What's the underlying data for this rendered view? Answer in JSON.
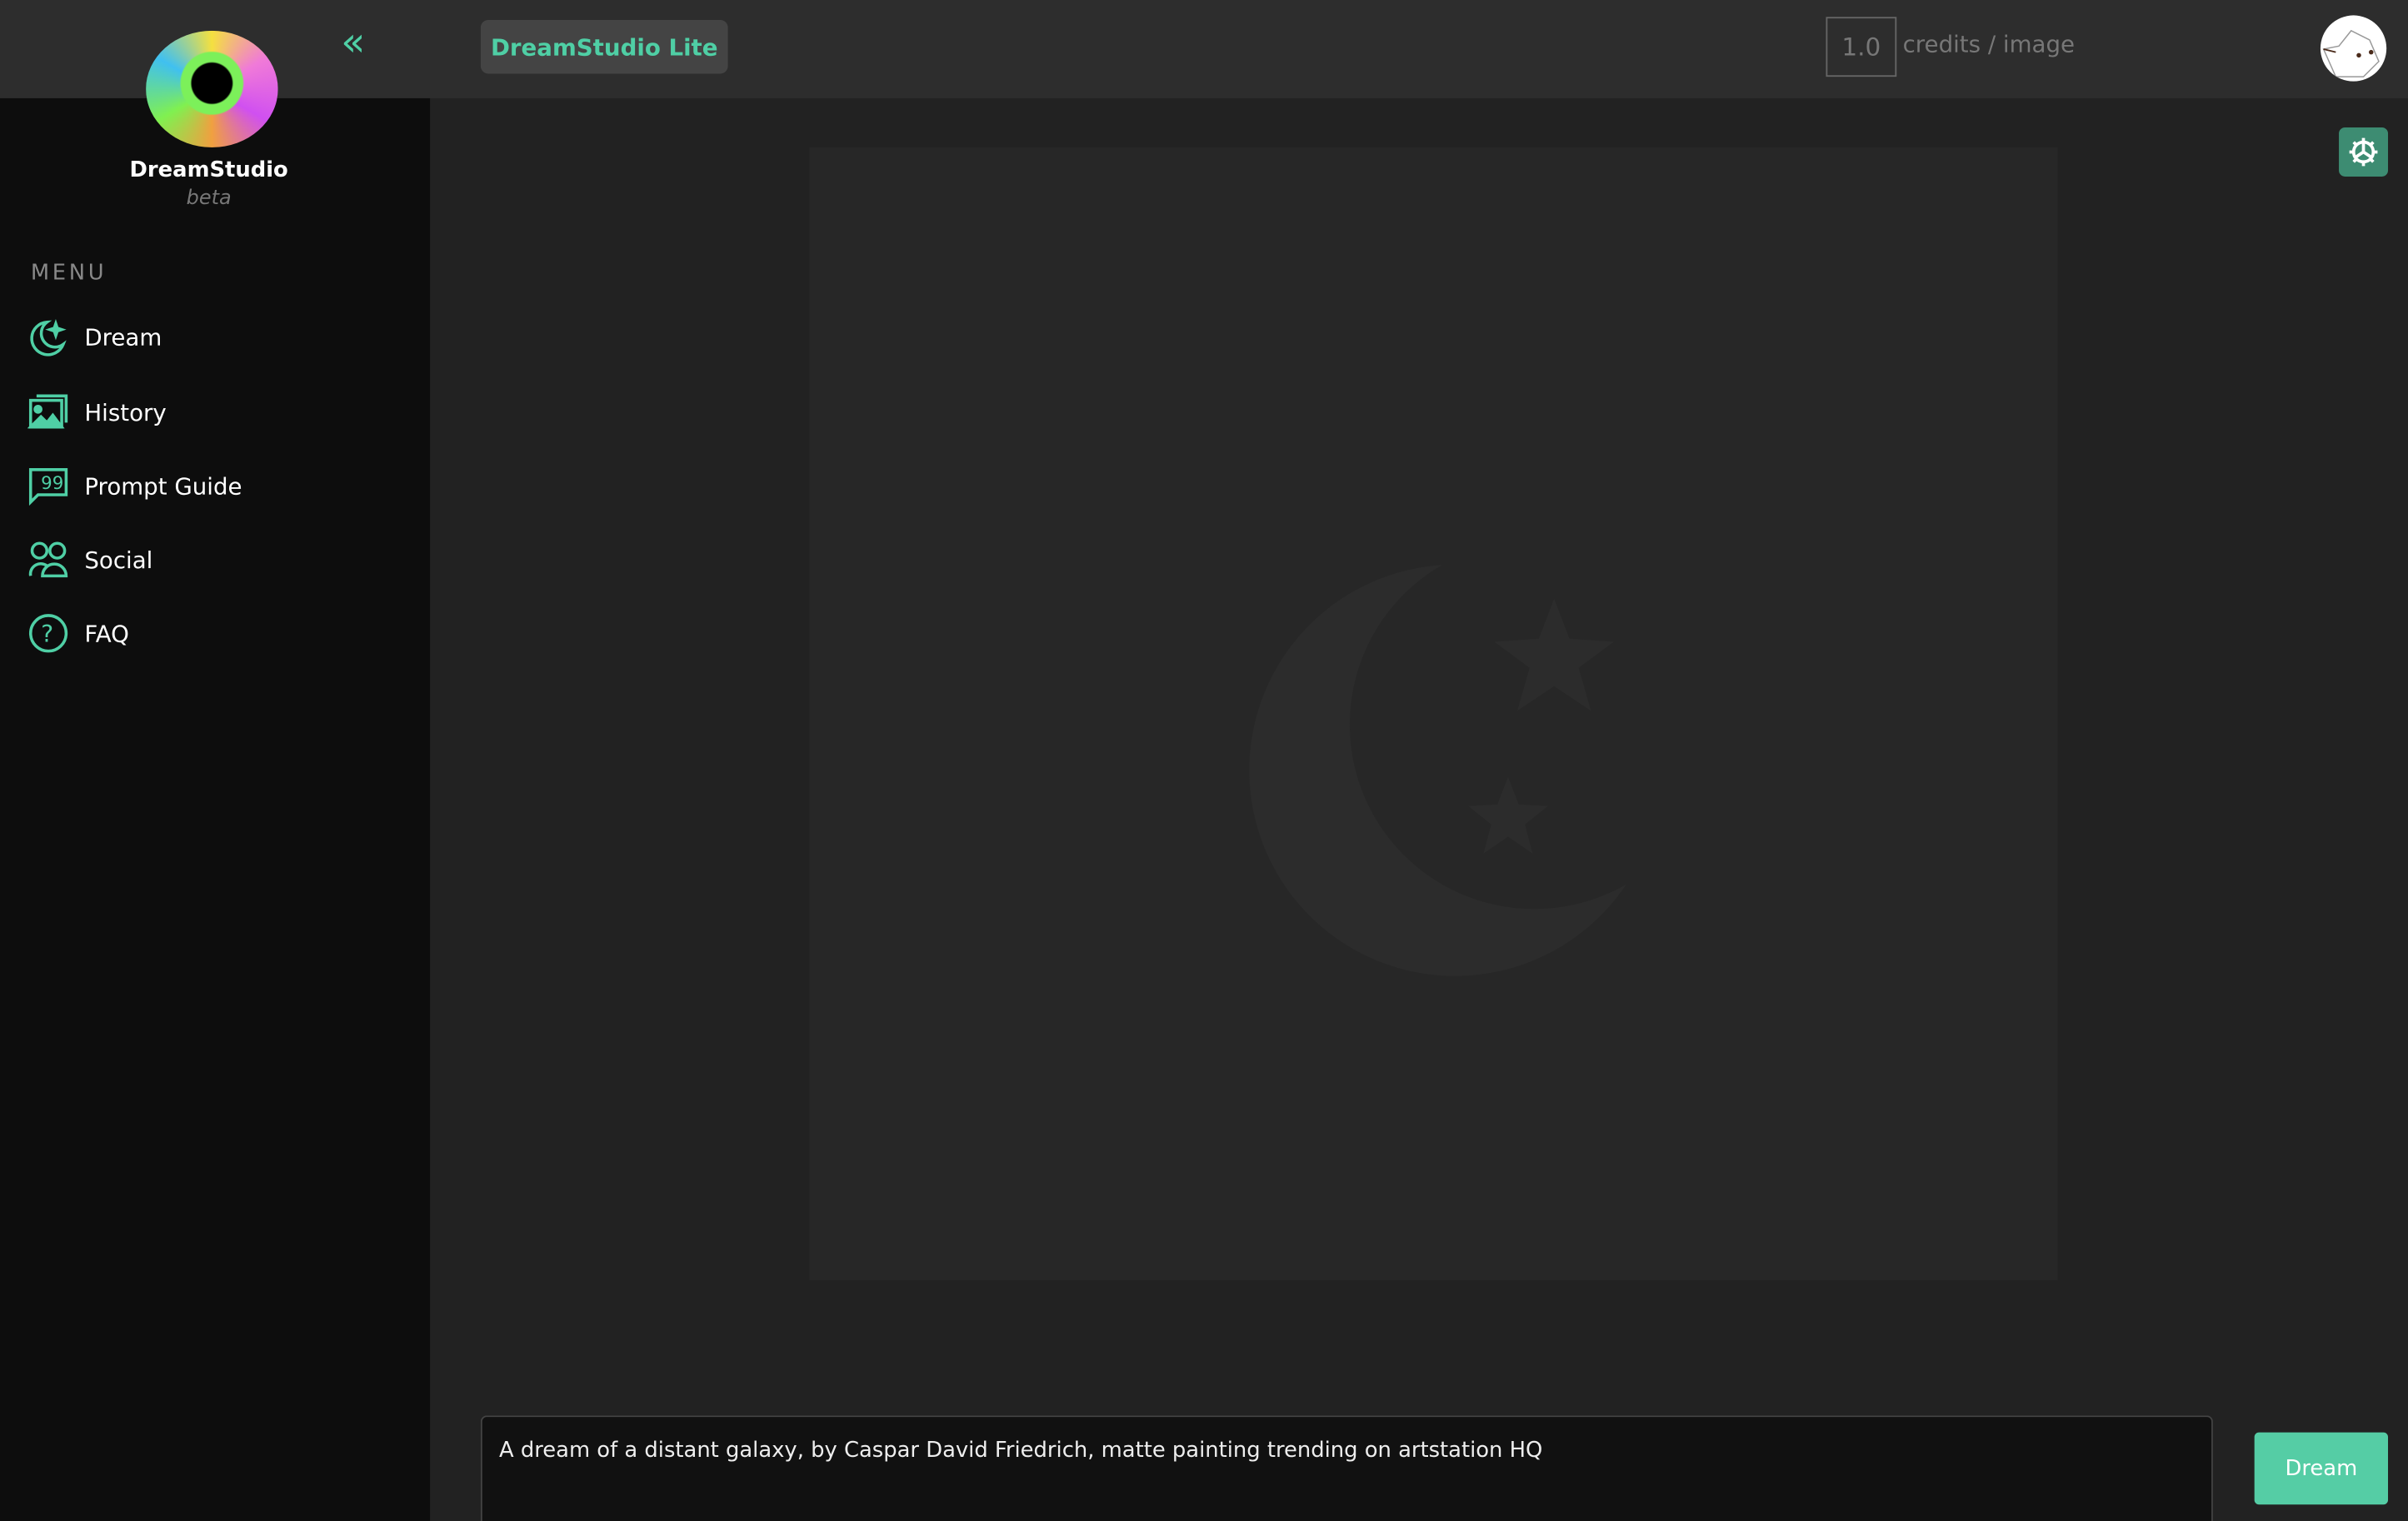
{
  "brand": {
    "name": "DreamStudio",
    "tag": "beta"
  },
  "header": {
    "product_label": "DreamStudio Lite",
    "credits_value": "1.0",
    "credits_label": "credits / image"
  },
  "sidebar": {
    "menu_label": "MENU",
    "items": [
      {
        "label": "Dream",
        "icon": "moon-stars-icon"
      },
      {
        "label": "History",
        "icon": "images-icon"
      },
      {
        "label": "Prompt Guide",
        "icon": "quote-chat-icon"
      },
      {
        "label": "Social",
        "icon": "users-icon"
      },
      {
        "label": "FAQ",
        "icon": "question-circle-icon"
      }
    ]
  },
  "prompt": {
    "value": "A dream of a distant galaxy, by Caspar David Friedrich, matte painting trending on artstation HQ"
  },
  "actions": {
    "dream_label": "Dream"
  },
  "colors": {
    "accent": "#4fcfa5",
    "button": "#55cda5",
    "settings": "#3d8c72"
  }
}
